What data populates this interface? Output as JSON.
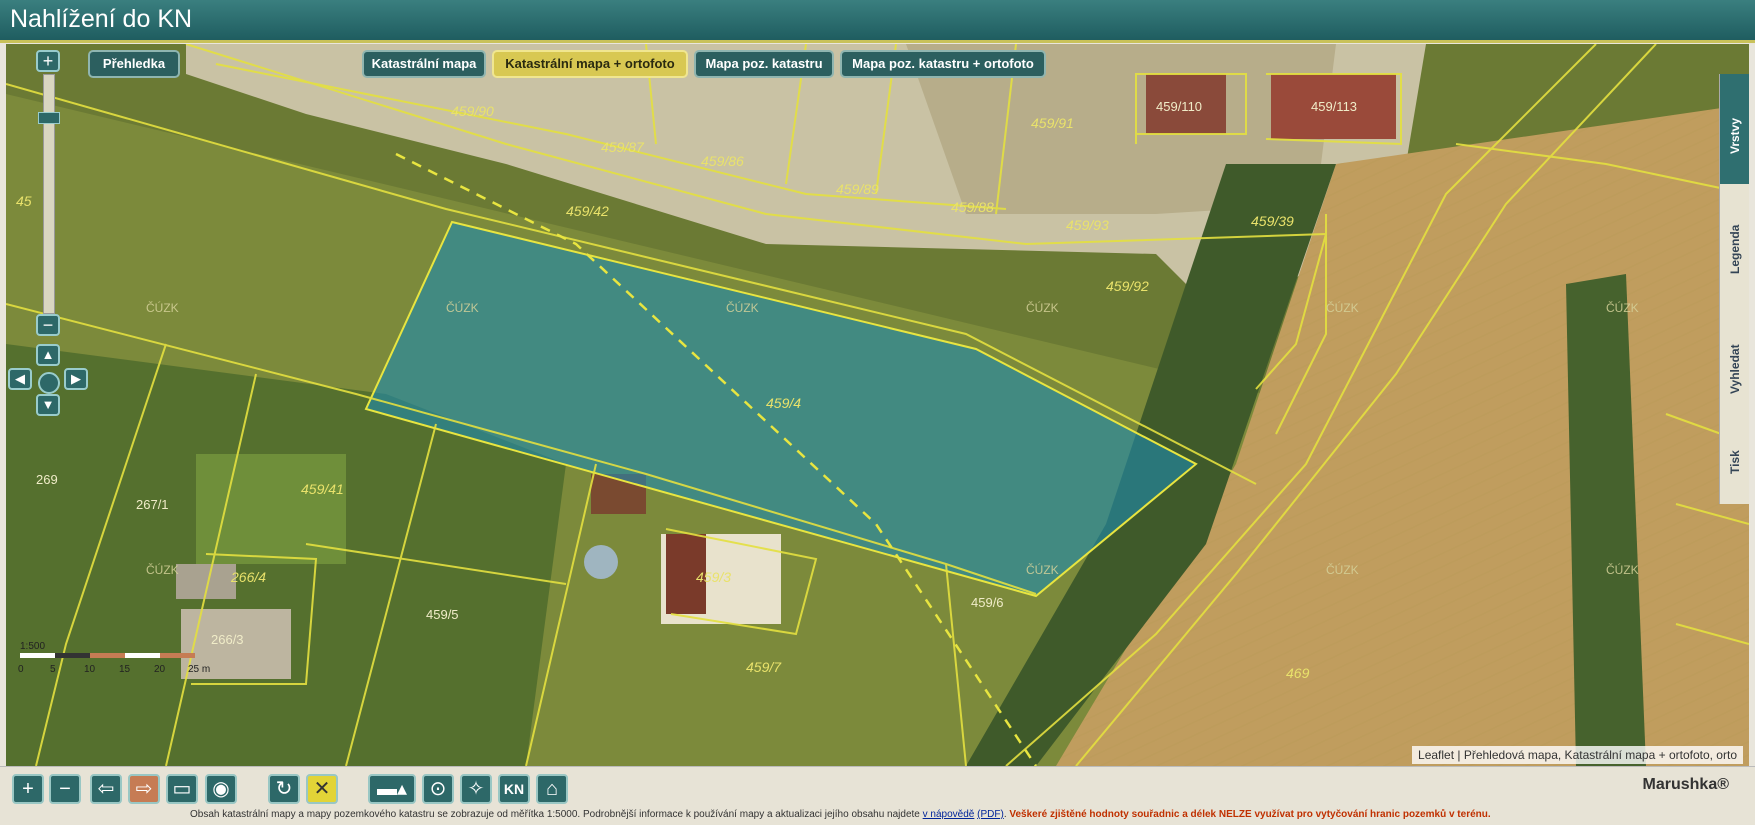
{
  "app": {
    "title": "Nahlížení do KN"
  },
  "map_switch": {
    "overview": "Přehledka",
    "layers": [
      "Katastrální mapa",
      "Katastrální mapa + ortofoto",
      "Mapa poz. katastru",
      "Mapa poz. katastru + ortofoto"
    ],
    "active_layer": "Katastrální mapa + ortofoto"
  },
  "side_tabs": [
    "Vrstvy",
    "Legenda",
    "Vyhledat",
    "Tisk"
  ],
  "zoom": {
    "in": "+",
    "out": "−"
  },
  "parcels": [
    "459/90",
    "459/87",
    "459/86",
    "459/89",
    "459/88",
    "459/110",
    "459/113",
    "459/91",
    "459/42",
    "459/92",
    "459/4",
    "459/41",
    "267/1",
    "269",
    "266/4",
    "266/3",
    "459/5",
    "459/6",
    "459/3",
    "459/7",
    "469",
    "459/39",
    "459/93",
    "45"
  ],
  "watermark": "ČÚZK",
  "scale_bar": {
    "labels": [
      "0",
      "5",
      "10",
      "15",
      "20",
      "25 m"
    ],
    "ratio": "1:500"
  },
  "attribution": "Leaflet | Přehledová mapa, Katastrální mapa + ortofoto, orto",
  "toolbar": {
    "icons": [
      "zoom-in-icon",
      "zoom-out-icon",
      "back-icon",
      "forward-icon",
      "select-rectangle-icon",
      "globe-icon",
      "refresh-icon",
      "clear-icon",
      "measure-icon",
      "marker-icon",
      "locate-icon",
      "kn-icon",
      "info-icon"
    ],
    "kn_label": "KN"
  },
  "footer": {
    "note": "Obsah katastrální mapy a mapy pozemkového katastru se zobrazuje od měřítka 1:5000. Podrobnější informace k používání mapy a aktualizaci jejího obsahu najdete",
    "link": "v nápovědě",
    "pdf": "(PDF)",
    "warning": "Veškeré zjištěné hodnoty souřadnic a délek NELZE využívat pro vytyčování hranic pozemků v terénu.",
    "brand": "Marushka®"
  },
  "colors": {
    "header": "#2a6b6c",
    "parcel_line": "#e4e040",
    "highlight": "#1a8aa8",
    "button": "#2c5f5f"
  }
}
